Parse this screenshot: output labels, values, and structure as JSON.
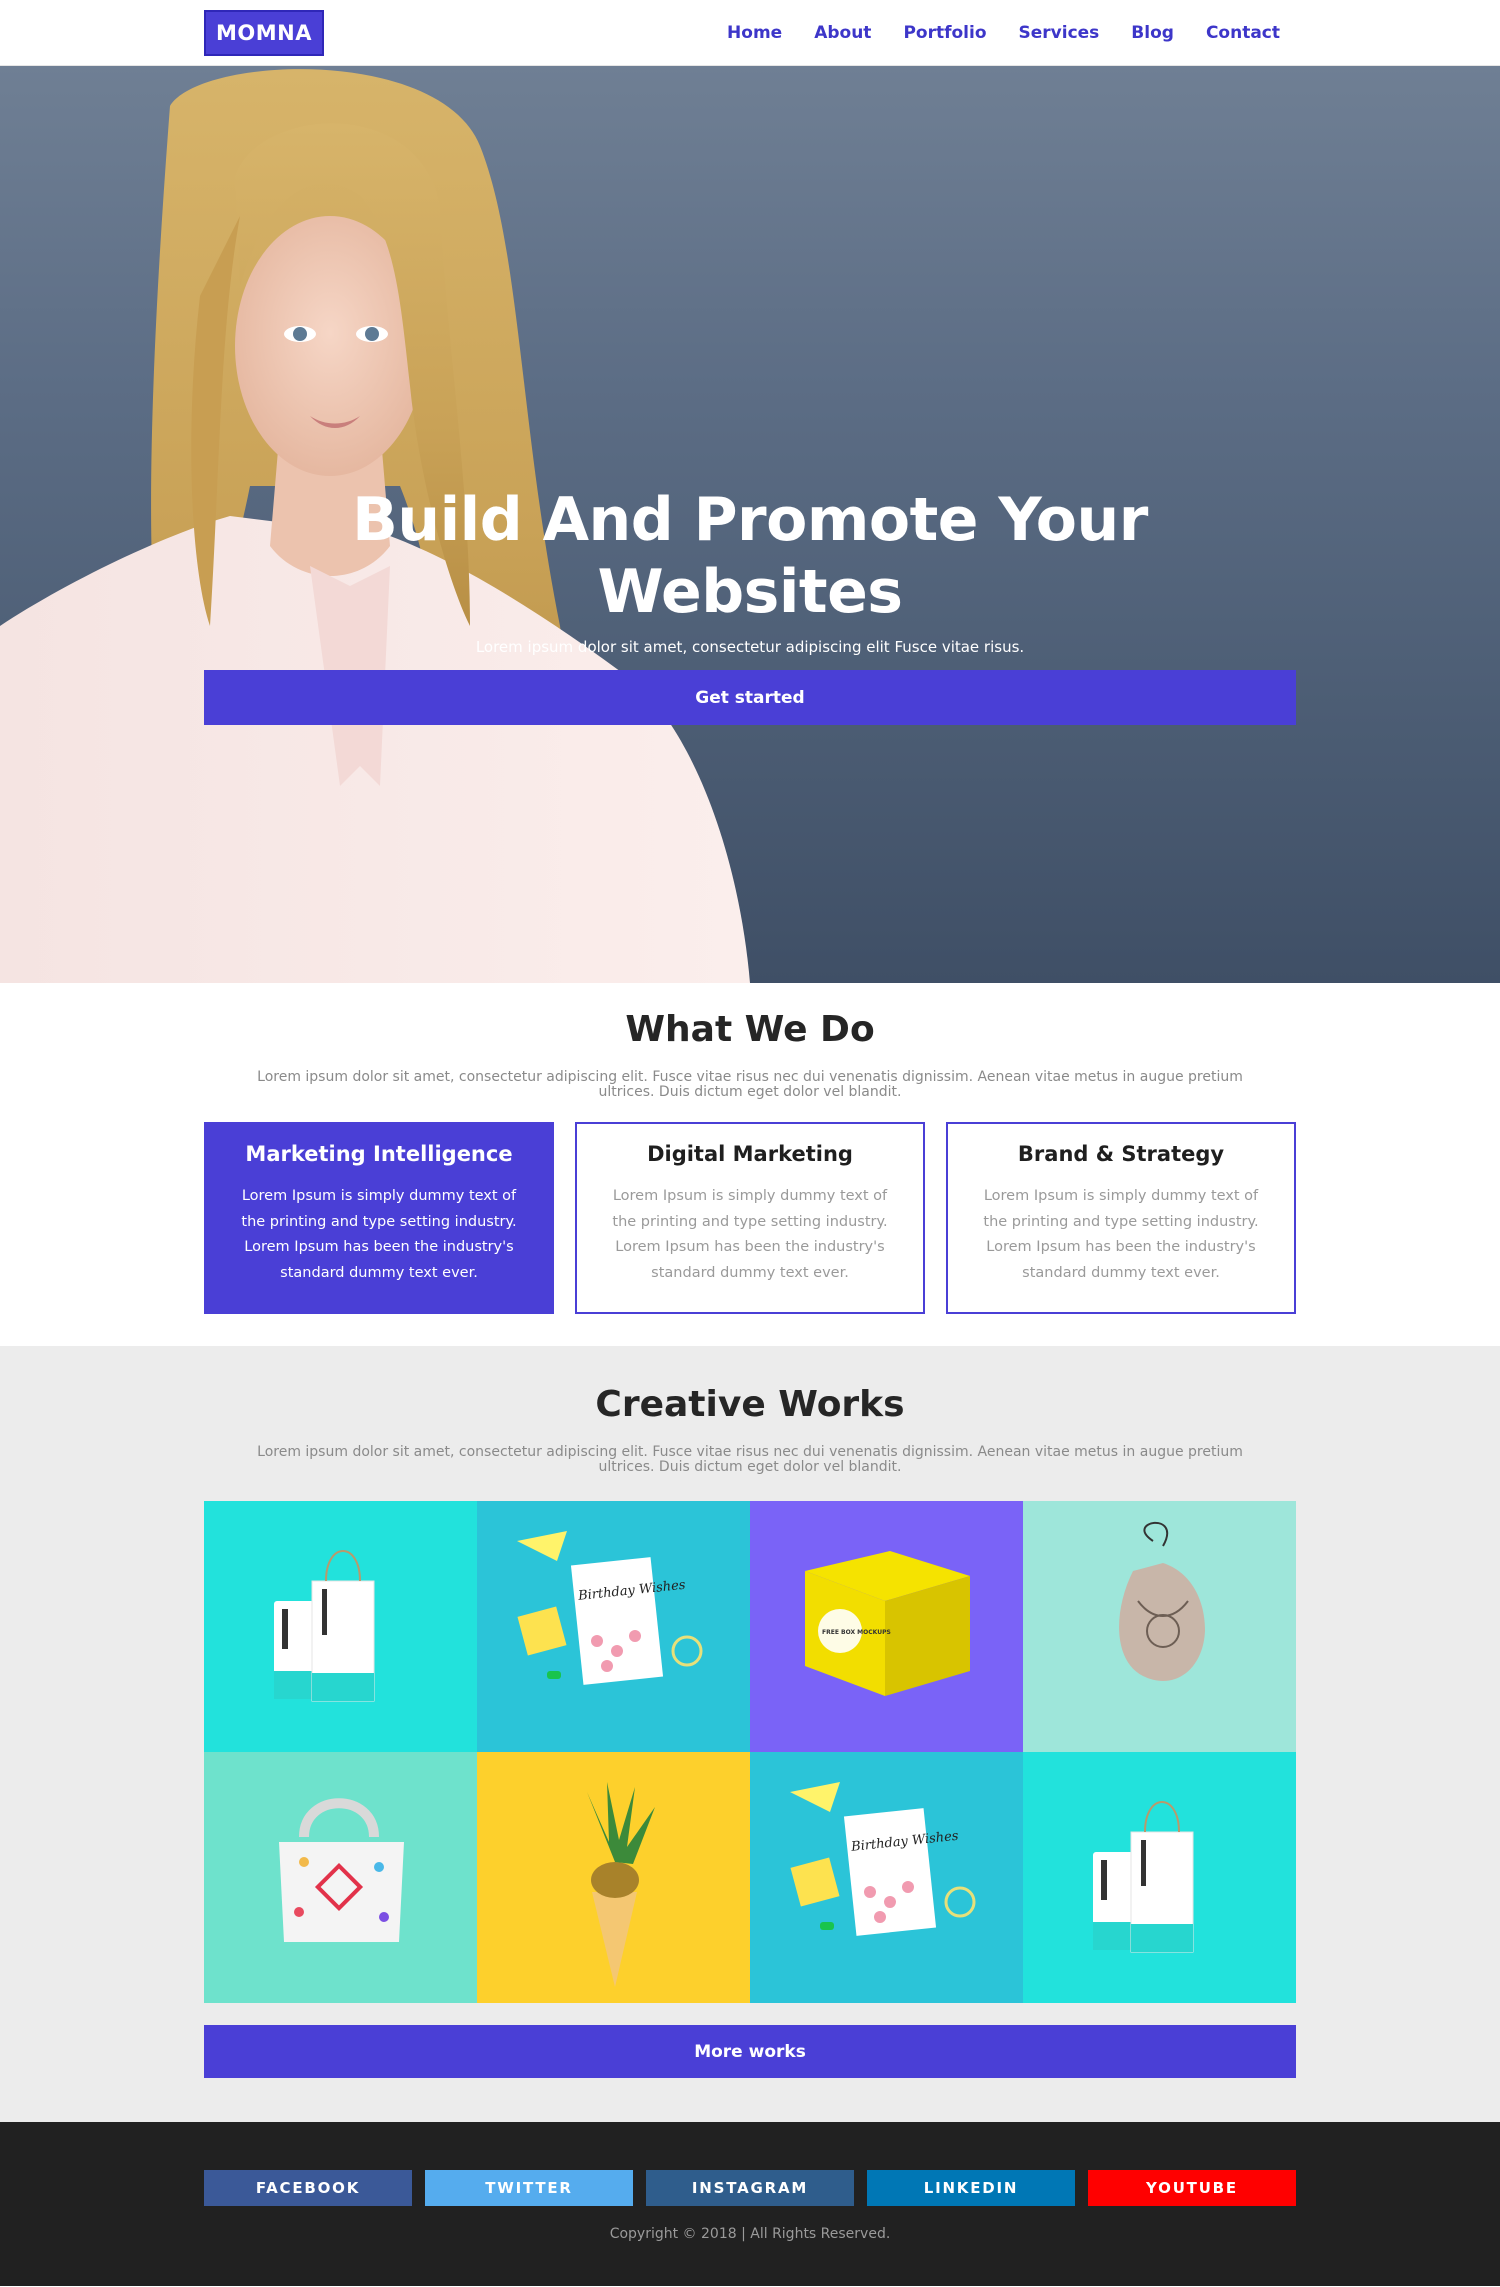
{
  "navbar": {
    "logo": "MOMNA",
    "links": [
      "Home",
      "About",
      "Portfolio",
      "Services",
      "Blog",
      "Contact"
    ]
  },
  "hero": {
    "title": "Build And Promote Your Websites",
    "subtitle": "Lorem ipsum dolor sit amet, consectetur adipiscing elit Fusce vitae risus.",
    "button": "Get started"
  },
  "whatwedo": {
    "title": "What We Do",
    "description": "Lorem ipsum dolor sit amet, consectetur adipiscing elit. Fusce vitae risus nec dui venenatis dignissim. Aenean vitae metus in augue pretium ultrices. Duis dictum eget dolor vel blandit.",
    "cards": [
      {
        "title": "Marketing Intelligence",
        "text": "Lorem Ipsum is simply dummy text of the printing and type setting industry. Lorem Ipsum has been the industry's standard dummy text ever."
      },
      {
        "title": "Digital Marketing",
        "text": "Lorem Ipsum is simply dummy text of the printing and type setting industry. Lorem Ipsum has been the industry's standard dummy text ever."
      },
      {
        "title": "Brand & Strategy",
        "text": "Lorem Ipsum is simply dummy text of the printing and type setting industry. Lorem Ipsum has been the industry's standard dummy text ever."
      }
    ]
  },
  "works": {
    "title": "Creative Works",
    "description": "Lorem ipsum dolor sit amet, consectetur adipiscing elit. Fusce vitae risus nec dui venenatis dignissim. Aenean vitae metus in augue pretium ultrices. Duis dictum eget dolor vel blandit.",
    "tiles": [
      {
        "kind": "bag-pack",
        "bg": "#22e2dc"
      },
      {
        "kind": "birthday-card",
        "bg": "#2bc4d8",
        "text": "Birthday Wishes"
      },
      {
        "kind": "yellow-box",
        "bg": "#7a63f7",
        "text": "FREE BOX MOCKUPS"
      },
      {
        "kind": "pouch",
        "bg": "#9ee6da"
      },
      {
        "kind": "tote-bag",
        "bg": "#6ee2cc"
      },
      {
        "kind": "pineapple-cone",
        "bg": "#fdd02c"
      },
      {
        "kind": "birthday-card",
        "bg": "#2bc4d8",
        "text": "Birthday Wishes"
      },
      {
        "kind": "bag-pack",
        "bg": "#22e2dc"
      }
    ],
    "button": "More works"
  },
  "footer": {
    "socials": [
      {
        "label": "FACEBOOK",
        "color": "#3b5998"
      },
      {
        "label": "TWITTER",
        "color": "#55acee"
      },
      {
        "label": "INSTAGRAM",
        "color": "#2f5d8c"
      },
      {
        "label": "LINKEDIN",
        "color": "#0077b5"
      },
      {
        "label": "YOUTUBE",
        "color": "#ff0000"
      }
    ],
    "copyright": "Copyright © 2018 | All Rights Reserved."
  }
}
